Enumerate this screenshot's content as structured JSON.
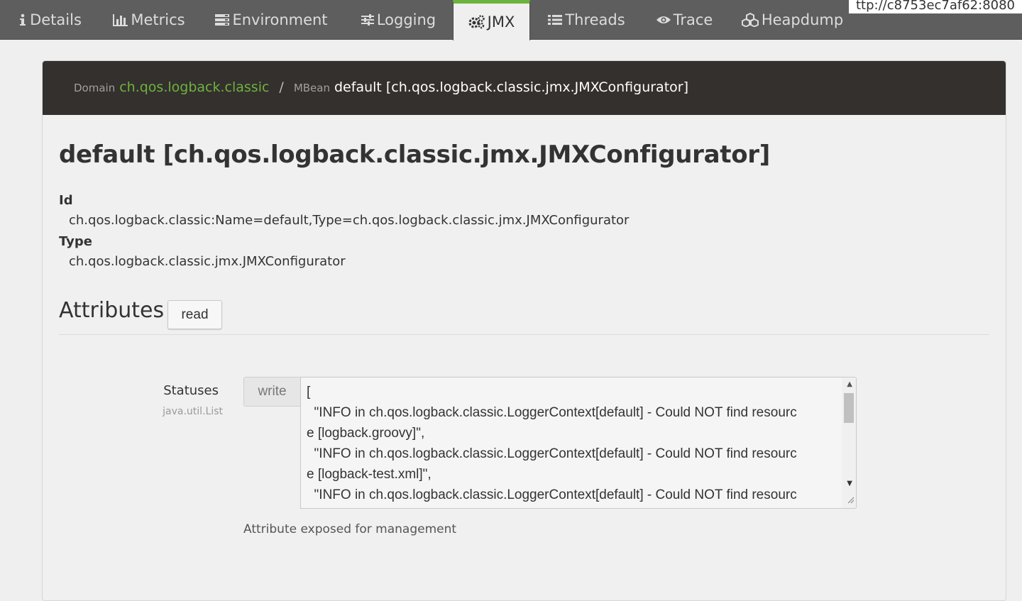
{
  "nav": {
    "tabs": [
      {
        "label": "Details",
        "icon": "info-icon"
      },
      {
        "label": "Metrics",
        "icon": "bar-chart-icon"
      },
      {
        "label": "Environment",
        "icon": "server-icon"
      },
      {
        "label": "Logging",
        "icon": "sliders-icon"
      },
      {
        "label": "JMX",
        "icon": "cogs-icon",
        "active": true
      },
      {
        "label": "Threads",
        "icon": "list-icon"
      },
      {
        "label": "Trace",
        "icon": "eye-icon"
      },
      {
        "label": "Heapdump",
        "icon": "cubes-icon"
      }
    ],
    "url_fragment": "ttp://c8753ec7af62:8080"
  },
  "breadcrumb": {
    "domain_label": "Domain",
    "domain_value": "ch.qos.logback.classic",
    "separator": "/",
    "mbean_label": "MBean",
    "mbean_value": "default [ch.qos.logback.classic.jmx.JMXConfigurator]"
  },
  "mbean": {
    "title": "default [ch.qos.logback.classic.jmx.JMXConfigurator]",
    "id_label": "Id",
    "id_value": "ch.qos.logback.classic:Name=default,Type=ch.qos.logback.classic.jmx.JMXConfigurator",
    "type_label": "Type",
    "type_value": "ch.qos.logback.classic.jmx.JMXConfigurator"
  },
  "attributes": {
    "heading": "Attributes",
    "read_label": "read",
    "items": [
      {
        "name": "Statuses",
        "type": "java.util.List",
        "write_label": "write",
        "value": "[\n  \"INFO in ch.qos.logback.classic.LoggerContext[default] - Could NOT find resourc\ne [logback.groovy]\",\n  \"INFO in ch.qos.logback.classic.LoggerContext[default] - Could NOT find resourc\ne [logback-test.xml]\",\n  \"INFO in ch.qos.logback.classic.LoggerContext[default] - Could NOT find resourc",
        "description": "Attribute exposed for management"
      }
    ]
  },
  "colors": {
    "nav_bg": "#5e5e5e",
    "accent_green": "#6db33f",
    "panel_header_bg": "#34302d",
    "page_bg": "#efefef"
  }
}
